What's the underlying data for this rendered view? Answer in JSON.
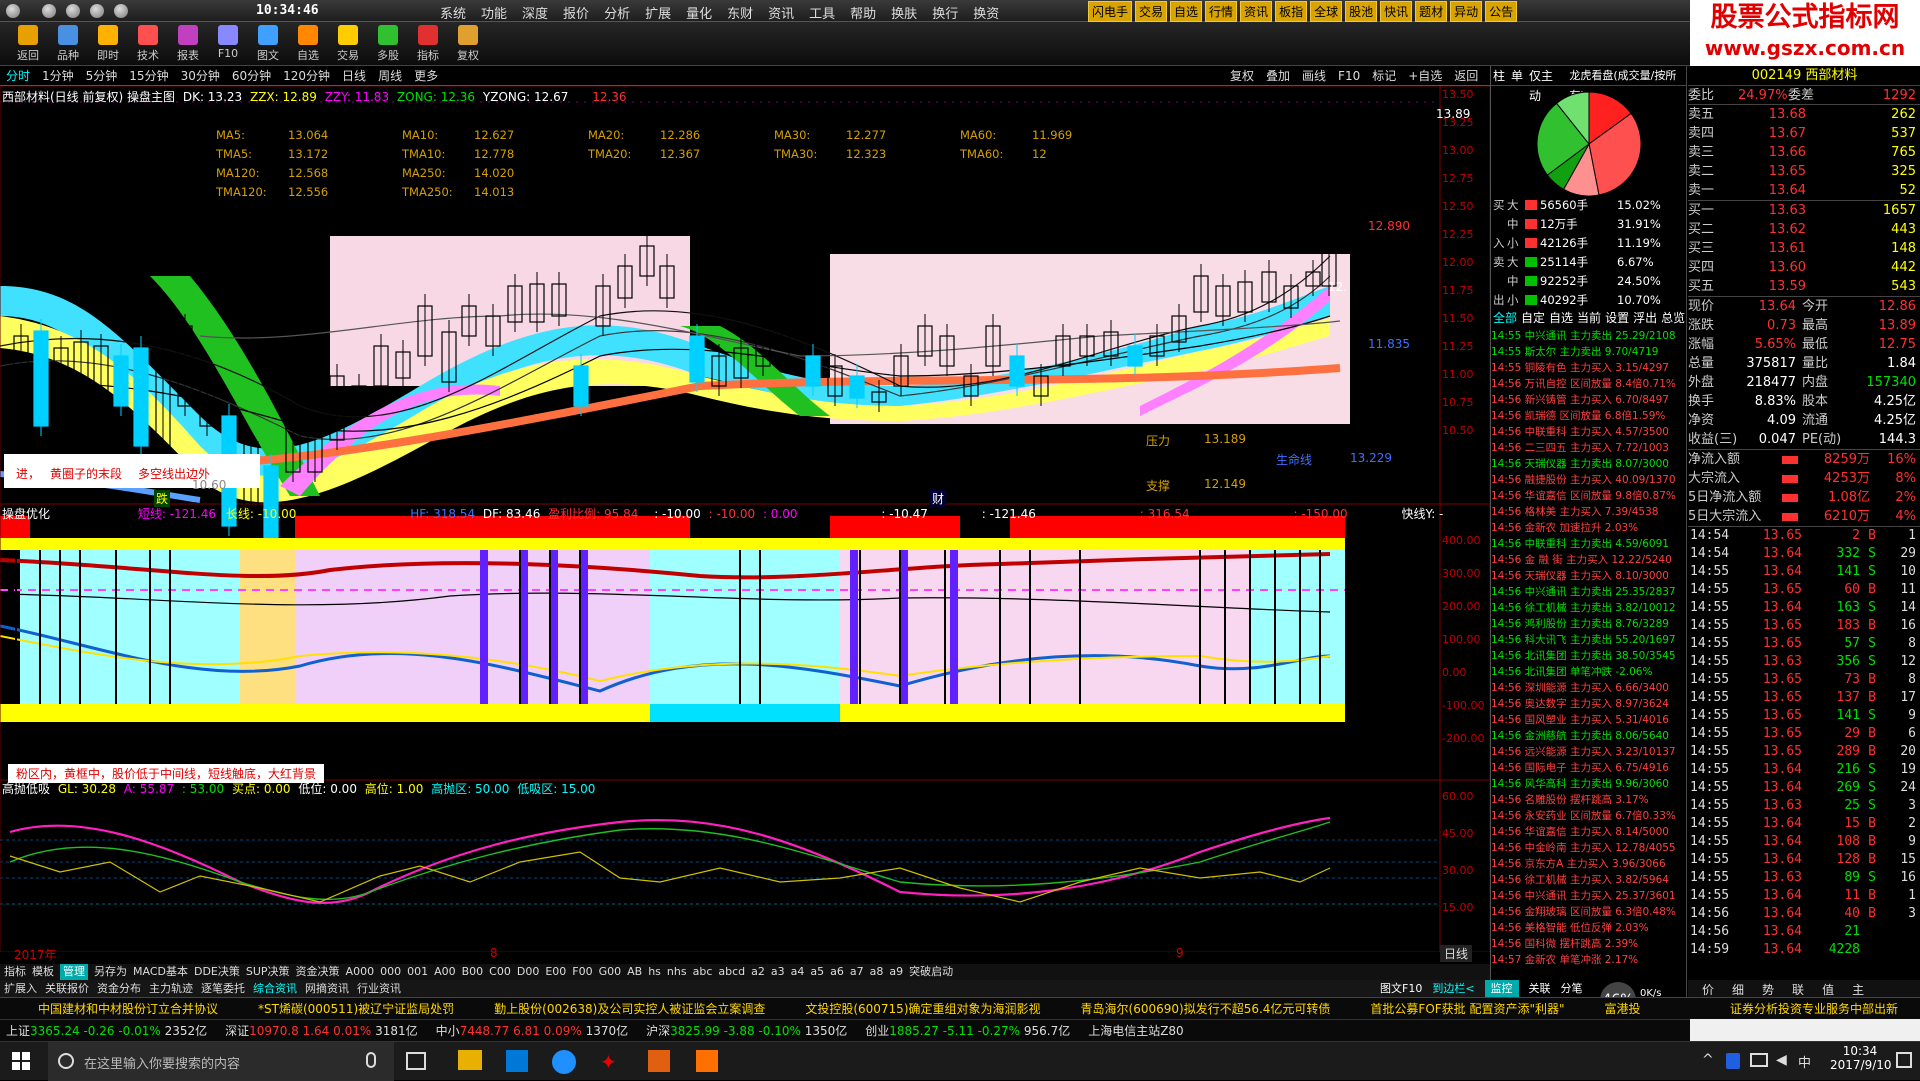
{
  "window": {
    "clock": "10:34:46"
  },
  "menu": [
    "系统",
    "功能",
    "深度",
    "报价",
    "分析",
    "扩展",
    "量化",
    "东财",
    "资讯",
    "工具",
    "帮助",
    "换肤",
    "换行",
    "换资"
  ],
  "menu_tags": [
    "闪电手",
    "交易",
    "自选",
    "行情",
    "资讯",
    "板指",
    "全球",
    "股池",
    "快讯",
    "题材",
    "异动",
    "公告"
  ],
  "ad": {
    "line1": "股票公式指标网",
    "line2": "www.gszx.com.cn"
  },
  "toolbar": [
    {
      "label": "返回",
      "icon": "back-icon",
      "color": "#e8a000"
    },
    {
      "label": "品种",
      "icon": "list-icon",
      "color": "#4a90e2"
    },
    {
      "label": "即时",
      "icon": "lightning-icon",
      "color": "#ffb000"
    },
    {
      "label": "技术",
      "icon": "chart-icon",
      "color": "#ff5050"
    },
    {
      "label": "报表",
      "icon": "table-icon",
      "color": "#c040c0"
    },
    {
      "label": "F10",
      "icon": "f10-icon",
      "color": "#8888ff"
    },
    {
      "label": "图文",
      "icon": "image-icon",
      "color": "#40a0ff"
    },
    {
      "label": "自选",
      "icon": "star-icon",
      "color": "#ff8800"
    },
    {
      "label": "交易",
      "icon": "person-icon",
      "color": "#ffcc00"
    },
    {
      "label": "多股",
      "icon": "grid-icon",
      "color": "#30c030"
    },
    {
      "label": "指标",
      "icon": "check-icon",
      "color": "#e03030"
    },
    {
      "label": "复权",
      "icon": "pen-icon",
      "color": "#e0a030"
    }
  ],
  "periods": [
    "分时",
    "1分钟",
    "5分钟",
    "15分钟",
    "30分钟",
    "60分钟",
    "120分钟",
    "日线",
    "周线",
    "更多"
  ],
  "right_tools": [
    "复权",
    "叠加",
    "画线",
    "F10",
    "标记",
    "+自选",
    "返回"
  ],
  "chart_top": {
    "title": "西部材料(日线 前复权) 操盘主图",
    "dk": "DK: 13.23",
    "zzx": "ZZX: 12.89",
    "zzy": "ZZY: 11.83",
    "zong": "ZONG: 12.36",
    "yzong": "YZONG: 12.67",
    "extra": "12.36",
    "ma": [
      [
        "MA5:",
        "13.064",
        "MA10:",
        "12.627",
        "MA20:",
        "12.286",
        "MA30:",
        "12.277",
        "MA60:",
        "11.969"
      ],
      [
        "TMA5:",
        "13.172",
        "TMA10:",
        "12.778",
        "TMA20:",
        "12.367",
        "TMA30:",
        "12.323",
        "TMA60:",
        "12"
      ],
      [
        "MA120:",
        "12.568",
        "MA250:",
        "14.020",
        "",
        "",
        "",
        "",
        "",
        ""
      ],
      [
        "TMA120:",
        "12.556",
        "TMA250:",
        "14.013",
        "",
        "",
        "",
        "",
        "",
        ""
      ]
    ],
    "high_label": "13.89",
    "price_label1": "12.890",
    "price_label2": "11.835",
    "price_label3": "12.",
    "yaxis": [
      "13.50",
      "13.25",
      "13.00",
      "12.75",
      "12.50",
      "12.25",
      "12.00",
      "11.75",
      "11.50",
      "11.25",
      "11.00",
      "10.75",
      "10.50"
    ],
    "pressure": "压力",
    "pressure_val": "13.189",
    "support": "支撑",
    "support_val": "12.149",
    "lifeline": "生命线",
    "lifeline_val": "13.229",
    "note1": "进，",
    "note2": "黄圈子的末段",
    "note3": "多空线出边外",
    "low_label": "跌",
    "low_val": "10.60",
    "cai": "财"
  },
  "chart_mid": {
    "title": "操盘优化",
    "a": "短线: -121.46",
    "b": "长线: -10.00",
    "c": "HF: 318.54",
    "d": "DF: 83.46",
    "e": "盈利比例: 95.84",
    "f": ": -10.00",
    "g": ": -10.00",
    "h": ": 0.00",
    "i": ": -10.47",
    "j": ": -121.46",
    "k": ": 316.54",
    "l": ": -150.00",
    "fast": "快线Y: -",
    "yaxis": [
      "400.00",
      "300.00",
      "200.00",
      "100.00",
      "0.00",
      "-100.00",
      "-200.00"
    ],
    "note": "粉区内，黄框中，股价低于中间线，短线触底，大红背景"
  },
  "chart_bot": {
    "title": "高抛低吸",
    "gl": "GL: 30.28",
    "a": "A: 55.87",
    "b": ": 53.00",
    "c": "买点: 0.00",
    "d": "低位: 0.00",
    "e": "高位: 1.00",
    "f": "高抛区: 50.00",
    "g": "低吸区: 15.00",
    "yaxis": [
      "60.00",
      "45.00",
      "30.00",
      "15.00"
    ],
    "x_labels": [
      "2017年",
      "8",
      "9"
    ]
  },
  "bottom_tabs": [
    "指标",
    "模板",
    "管理",
    "另存为",
    "MACD基本",
    "DDE决策",
    "SUP决策",
    "资金决策",
    "A000",
    "000",
    "001",
    "A00",
    "B00",
    "C00",
    "D00",
    "E00",
    "F00",
    "G00",
    "AB",
    "hs",
    "nhs",
    "abc",
    "abcd",
    "a2",
    "a3",
    "a4",
    "a5",
    "a6",
    "a7",
    "a8",
    "a9",
    "突破启动"
  ],
  "bottom_tabs2": [
    "扩展入",
    "关联报价",
    "资金分布",
    "主力轨迹",
    "逐笔委托",
    "综合资讯",
    "网摘资讯",
    "行业资讯"
  ],
  "bottom_right": [
    "日线",
    "图文F10",
    "到边栏<",
    "监控",
    "关联",
    "分笔"
  ],
  "right_panel": {
    "vert_tabs": [
      "柱",
      "单",
      "仅主动",
      "龙虎看盘(成交量/按所有)"
    ],
    "flow": [
      [
        "买",
        "大",
        "56560手",
        "15.02%"
      ],
      [
        "",
        "中",
        "12万手",
        "31.91%"
      ],
      [
        "入",
        "小",
        "42126手",
        "11.19%"
      ],
      [
        "卖",
        "大",
        "25114手",
        "6.67%"
      ],
      [
        "",
        "中",
        "92252手",
        "24.50%"
      ],
      [
        "出",
        "小",
        "40292手",
        "10.70%"
      ]
    ],
    "flow_tabs": [
      "全部",
      "自定",
      "自选",
      "当前",
      "设置",
      "浮出",
      "总览"
    ],
    "alerts": [
      [
        "14:55",
        "中兴通讯",
        "主力卖出",
        "25.29/2108"
      ],
      [
        "14:55",
        "斯太尔",
        "主力卖出",
        "9.70/4719"
      ],
      [
        "14:55",
        "铜陵有色",
        "主力买入",
        "3.15/4297"
      ],
      [
        "14:56",
        "万讯自控",
        "区间放量",
        "8.4倍0.71%"
      ],
      [
        "14:56",
        "新兴铸管",
        "主力买入",
        "6.70/8497"
      ],
      [
        "14:56",
        "凯瑞德",
        "区间放量",
        "6.8倍1.59%"
      ],
      [
        "14:56",
        "中联重科",
        "主力买入",
        "4.57/3500"
      ],
      [
        "14:56",
        "二三四五",
        "主力买入",
        "7.72/1003"
      ],
      [
        "14:56",
        "天瑞仪器",
        "主力卖出",
        "8.07/3000"
      ],
      [
        "14:56",
        "融捷股份",
        "主力买入",
        "40.09/1370"
      ],
      [
        "14:56",
        "华谊嘉信",
        "区间放量",
        "9.8倍0.87%"
      ],
      [
        "14:56",
        "格林美",
        "主力买入",
        "7.39/4538"
      ],
      [
        "14:56",
        "金新农",
        "加速拉升",
        "2.03%"
      ],
      [
        "14:56",
        "中联重科",
        "主力卖出",
        "4.59/6091"
      ],
      [
        "14:56",
        "金  融  街",
        "主力买入",
        "12.22/5240"
      ],
      [
        "14:56",
        "天瑞仪器",
        "主力买入",
        "8.10/3000"
      ],
      [
        "14:56",
        "中兴通讯",
        "主力卖出",
        "25.35/2837"
      ],
      [
        "14:56",
        "徐工机械",
        "主力卖出",
        "3.82/10012"
      ],
      [
        "14:56",
        "鸿利股份",
        "主力卖出",
        "8.76/3289"
      ],
      [
        "14:56",
        "科大讯飞",
        "主力卖出",
        "55.20/1697"
      ],
      [
        "14:56",
        "北讯集团",
        "主力卖出",
        "38.50/3545"
      ],
      [
        "14:56",
        "北讯集团",
        "单笔冲跌",
        "-2.06%"
      ],
      [
        "14:56",
        "深圳能源",
        "主力买入",
        "6.66/3400"
      ],
      [
        "14:56",
        "奥达数字",
        "主力买入",
        "8.97/3624"
      ],
      [
        "14:56",
        "国风塑业",
        "主力买入",
        "5.31/4016"
      ],
      [
        "14:56",
        "金洲慈航",
        "主力卖出",
        "8.06/5640"
      ],
      [
        "14:56",
        "远兴能源",
        "主力买入",
        "3.23/10137"
      ],
      [
        "14:56",
        "国际电子",
        "主力买入",
        "6.75/4916"
      ],
      [
        "14:56",
        "风华高科",
        "主力卖出",
        "9.96/3060"
      ],
      [
        "14:56",
        "名雕股份",
        "摆杆跳高",
        "3.17%"
      ],
      [
        "14:56",
        "永安药业",
        "区间放量",
        "6.7倍0.33%"
      ],
      [
        "14:56",
        "华谊嘉信",
        "主力买入",
        "8.14/5000"
      ],
      [
        "14:56",
        "中金岭南",
        "主力买入",
        "12.78/4055"
      ],
      [
        "14:56",
        "京东方A",
        "主力买入",
        "3.96/3066"
      ],
      [
        "14:56",
        "徐工机械",
        "主力买入",
        "3.82/5964"
      ],
      [
        "14:56",
        "中兴通讯",
        "主力买入",
        "25.37/3601"
      ],
      [
        "14:56",
        "金翔玻璃",
        "区间放量",
        "6.3倍0.48%"
      ],
      [
        "14:56",
        "美格智能",
        "低位反弹",
        "2.03%"
      ],
      [
        "14:56",
        "国科微",
        "摆杆跳高",
        "2.39%"
      ],
      [
        "14:57",
        "金新农",
        "单笔冲涨",
        "2.17%"
      ]
    ],
    "stock": {
      "code": "002149",
      "name": "西部材料"
    },
    "weibi": {
      "label": "委比",
      "val": "24.97%",
      "label2": "委差",
      "val2": "1292"
    },
    "sells": [
      [
        "卖五",
        "13.68",
        "262"
      ],
      [
        "卖四",
        "13.67",
        "537"
      ],
      [
        "卖三",
        "13.66",
        "765"
      ],
      [
        "卖二",
        "13.65",
        "325"
      ],
      [
        "卖一",
        "13.64",
        "52"
      ]
    ],
    "buys": [
      [
        "买一",
        "13.63",
        "1657"
      ],
      [
        "买二",
        "13.62",
        "443"
      ],
      [
        "买三",
        "13.61",
        "148"
      ],
      [
        "买四",
        "13.60",
        "442"
      ],
      [
        "买五",
        "13.59",
        "543"
      ]
    ],
    "stats": [
      [
        "现价",
        "13.64",
        "今开",
        "12.86"
      ],
      [
        "涨跌",
        "0.73",
        "最高",
        "13.89"
      ],
      [
        "涨幅",
        "5.65%",
        "最低",
        "12.75"
      ],
      [
        "总量",
        "375817",
        "量比",
        "1.84"
      ],
      [
        "外盘",
        "218477",
        "内盘",
        "157340"
      ],
      [
        "换手",
        "8.83%",
        "股本",
        "4.25亿"
      ],
      [
        "净资",
        "4.09",
        "流通",
        "4.25亿"
      ],
      [
        "收益(三)",
        "0.047",
        "PE(动)",
        "144.3"
      ]
    ],
    "fund": [
      [
        "净流入额",
        "8259万",
        "16%"
      ],
      [
        "大宗流入",
        "4253万",
        "8%"
      ],
      [
        "5日净流入额",
        "1.08亿",
        "2%"
      ],
      [
        "5日大宗流入",
        "6210万",
        "4%"
      ]
    ],
    "trades": [
      [
        "14:54",
        "13.65",
        "2",
        "B",
        "1"
      ],
      [
        "14:54",
        "13.64",
        "332",
        "S",
        "29"
      ],
      [
        "14:55",
        "13.64",
        "141",
        "S",
        "10"
      ],
      [
        "14:55",
        "13.65",
        "60",
        "B",
        "11"
      ],
      [
        "14:55",
        "13.64",
        "163",
        "S",
        "14"
      ],
      [
        "14:55",
        "13.65",
        "183",
        "B",
        "16"
      ],
      [
        "14:55",
        "13.65",
        "57",
        "S",
        "8"
      ],
      [
        "14:55",
        "13.63",
        "356",
        "S",
        "12"
      ],
      [
        "14:55",
        "13.65",
        "73",
        "B",
        "8"
      ],
      [
        "14:55",
        "13.65",
        "137",
        "B",
        "17"
      ],
      [
        "14:55",
        "13.65",
        "141",
        "S",
        "9"
      ],
      [
        "14:55",
        "13.65",
        "29",
        "B",
        "6"
      ],
      [
        "14:55",
        "13.65",
        "289",
        "B",
        "20"
      ],
      [
        "14:55",
        "13.64",
        "216",
        "S",
        "19"
      ],
      [
        "14:55",
        "13.64",
        "269",
        "S",
        "24"
      ],
      [
        "14:55",
        "13.63",
        "25",
        "S",
        "3"
      ],
      [
        "14:55",
        "13.64",
        "15",
        "B",
        "2"
      ],
      [
        "14:55",
        "13.64",
        "108",
        "B",
        "9"
      ],
      [
        "14:55",
        "13.64",
        "128",
        "B",
        "15"
      ],
      [
        "14:55",
        "13.63",
        "89",
        "S",
        "16"
      ],
      [
        "14:55",
        "13.64",
        "11",
        "B",
        "1"
      ],
      [
        "14:56",
        "13.64",
        "40",
        "B",
        "3"
      ],
      [
        "14:56",
        "13.64",
        "21",
        "",
        ""
      ],
      [
        "14:59",
        "13.64",
        "4228",
        "",
        ""
      ]
    ],
    "bottom_icons": [
      "价",
      "细",
      "势",
      "联",
      "值",
      "主"
    ],
    "cpu": "46%",
    "speed": "0K/s"
  },
  "ticker": [
    "中国建材和中材股份订立合并协议",
    "*ST烯碳(000511)被辽宁证监局处罚",
    "勤上股份(002638)及公司实控人被证监会立案调查",
    "文投控股(600715)确定重组对象为海润影视",
    "青岛海尔(600690)拟发行不超56.4亿元可转债",
    "首批公募FOF获批 配置资产添\"利器\"",
    "富港投"
  ],
  "index_bar": [
    {
      "name": "上证",
      "val": "3365.24",
      "chg": "-0.26",
      "pct": "-0.01%",
      "amt": "2352亿"
    },
    {
      "name": "深证",
      "val": "10970.8",
      "chg": "1.64",
      "pct": "0.01%",
      "amt": "3181亿"
    },
    {
      "name": "中小",
      "val": "7448.77",
      "chg": "6.81",
      "pct": "0.09%",
      "amt": "1370亿"
    },
    {
      "name": "沪深",
      "val": "3825.99",
      "chg": "-3.88",
      "pct": "-0.10%",
      "amt": "1350亿"
    },
    {
      "name": "创业",
      "val": "1885.27",
      "chg": "-5.11",
      "pct": "-0.27%",
      "amt": "956.7亿"
    }
  ],
  "index_server": "上海电信主站Z80",
  "right_service": "证券分析投资专业服务中部出新",
  "taskbar": {
    "search": "在这里输入你要搜索的内容",
    "time": "10:34",
    "date": "2017/9/10"
  }
}
